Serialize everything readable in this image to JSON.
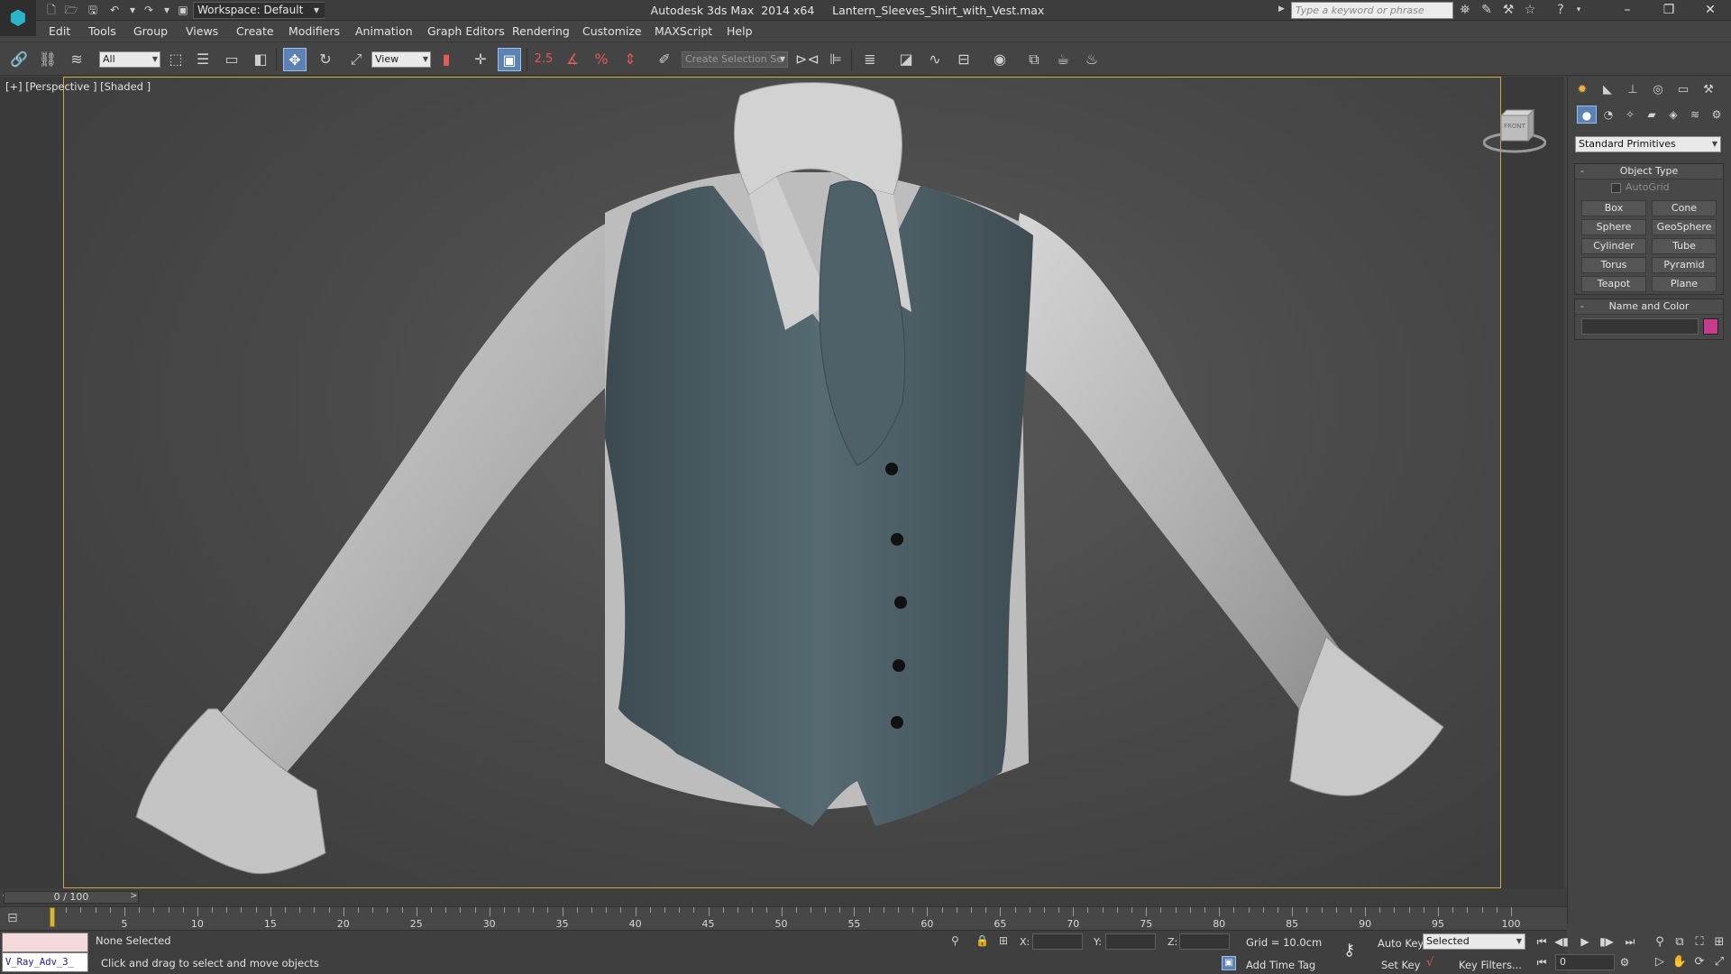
{
  "title_bar": {
    "app_title": "Autodesk 3ds Max  2014 x64     Lantern_Sleeves_Shirt_with_Vest.max",
    "workspace_label": "Workspace: Default",
    "search_placeholder": "Type a keyword or phrase"
  },
  "menu": {
    "items": [
      "Edit",
      "Tools",
      "Group",
      "Views",
      "Create",
      "Modifiers",
      "Animation",
      "Graph Editors",
      "Rendering",
      "Customize",
      "MAXScript",
      "Help"
    ]
  },
  "toolbar": {
    "selection_filter": "All",
    "ref_coord": "View",
    "snap_angle": "2.5",
    "selection_set_placeholder": "Create Selection Se"
  },
  "viewport": {
    "label": "[+] [Perspective ] [Shaded ]",
    "viewcube_label": "FRONT",
    "border_color": "#c9a845",
    "background_color": "#4a4a4a",
    "shirt_color": "#b9b9b9",
    "vest_color": "#4e5f66"
  },
  "command_panel": {
    "category_dropdown": "Standard Primitives",
    "object_type_title": "Object Type",
    "autogrid_label": "AutoGrid",
    "primitive_buttons": [
      "Box",
      "Cone",
      "Sphere",
      "GeoSphere",
      "Cylinder",
      "Tube",
      "Torus",
      "Pyramid",
      "Teapot",
      "Plane"
    ],
    "name_color_title": "Name and Color",
    "object_color": "#c83a8b"
  },
  "timeline": {
    "slider_label": "0 / 100",
    "ticks": [
      5,
      10,
      15,
      20,
      25,
      30,
      35,
      40,
      45,
      50,
      55,
      60,
      65,
      70,
      75,
      80,
      85,
      90,
      95,
      100
    ],
    "range_end": 100
  },
  "status": {
    "script_listener_text": "V_Ray_Adv_3_",
    "selection_status": "None Selected",
    "prompt_text": "Click and drag to select and move objects",
    "x_label": "X:",
    "y_label": "Y:",
    "z_label": "Z:",
    "grid_text": "Grid = 10.0cm",
    "add_time_tag": "Add Time Tag",
    "auto_key": "Auto Key",
    "set_key": "Set Key",
    "key_mode": "Selected",
    "key_filters": "Key Filters...",
    "current_frame": "0"
  }
}
